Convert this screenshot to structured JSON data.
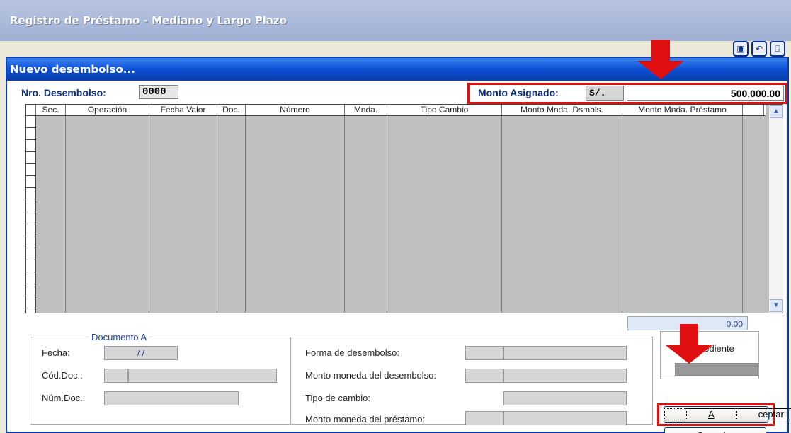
{
  "outer": {
    "title": "Registro de Préstamo - Mediano y Largo Plazo"
  },
  "dialog": {
    "title": "Nuevo desembolso...",
    "nro_label": "Nro. Desembolso:",
    "nro_value": "0000",
    "monto_label": "Monto Asignado:",
    "monto_currency": "S/.",
    "monto_value": "500,000.00"
  },
  "grid": {
    "columns": [
      "Sec.",
      "Operación",
      "Fecha Valor",
      "Doc.",
      "Número",
      "Mnda.",
      "Tipo Cambio",
      "Monto Mnda. Dsmbls.",
      "Monto Mnda. Préstamo"
    ],
    "total": "0.00"
  },
  "documento": {
    "legend": "Documento A",
    "fecha_label": "Fecha:",
    "fecha_value": " /  /",
    "cod_label": "Cód.Doc.:",
    "num_label": "Núm.Doc.:"
  },
  "desembolso": {
    "forma_label": "Forma de desembolso:",
    "monto_des_label": "Monto moneda del desembolso:",
    "tipo_cambio_label": "Tipo de cambio:",
    "monto_pres_label": "Monto moneda del préstamo:"
  },
  "expediente": {
    "label": "pediente"
  },
  "buttons": {
    "accept_prefix": "A",
    "accept_rest": "ceptar",
    "cancel_prefix": "C",
    "cancel_rest": "ancelar"
  },
  "colors": {
    "highlight": "#e01010",
    "title_blue": "#0b4fd4",
    "label_navy": "#0a2a7a"
  }
}
